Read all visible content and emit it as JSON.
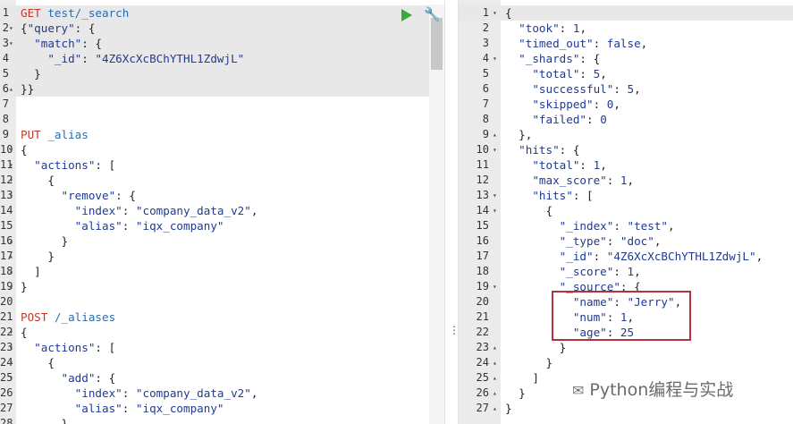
{
  "left_editor": {
    "lines": [
      {
        "n": "1",
        "fold": "",
        "hl": true,
        "tokens": [
          [
            "m",
            "GET"
          ],
          [
            "t",
            " "
          ],
          [
            "u",
            "test/_search"
          ]
        ]
      },
      {
        "n": "2",
        "fold": "▾",
        "hl": true,
        "tokens": [
          [
            "t",
            "{"
          ],
          [
            "k",
            "\"query\""
          ],
          [
            "t",
            ": {"
          ]
        ]
      },
      {
        "n": "3",
        "fold": "▾",
        "hl": true,
        "tokens": [
          [
            "t",
            "  "
          ],
          [
            "k",
            "\"match\""
          ],
          [
            "t",
            ": {"
          ]
        ]
      },
      {
        "n": "4",
        "fold": "",
        "hl": true,
        "tokens": [
          [
            "t",
            "    "
          ],
          [
            "k",
            "\"_id\""
          ],
          [
            "t",
            ": "
          ],
          [
            "s",
            "\"4Z6XcXcBChYTHL1ZdwjL\""
          ]
        ]
      },
      {
        "n": "5",
        "fold": "",
        "hl": true,
        "tokens": [
          [
            "t",
            "  }"
          ]
        ]
      },
      {
        "n": "6",
        "fold": "▴",
        "hl": true,
        "tokens": [
          [
            "t",
            "}}"
          ]
        ]
      },
      {
        "n": "7",
        "fold": "",
        "hl": false,
        "tokens": []
      },
      {
        "n": "8",
        "fold": "",
        "hl": false,
        "tokens": []
      },
      {
        "n": "9",
        "fold": "",
        "hl": false,
        "tokens": [
          [
            "m",
            "PUT"
          ],
          [
            "t",
            " "
          ],
          [
            "u",
            "_alias"
          ]
        ]
      },
      {
        "n": "10",
        "fold": "▾",
        "hl": false,
        "tokens": [
          [
            "t",
            "{"
          ]
        ]
      },
      {
        "n": "11",
        "fold": "▾",
        "hl": false,
        "tokens": [
          [
            "t",
            "  "
          ],
          [
            "k",
            "\"actions\""
          ],
          [
            "t",
            ": ["
          ]
        ]
      },
      {
        "n": "12",
        "fold": "▾",
        "hl": false,
        "tokens": [
          [
            "t",
            "    {"
          ]
        ]
      },
      {
        "n": "13",
        "fold": "▾",
        "hl": false,
        "tokens": [
          [
            "t",
            "      "
          ],
          [
            "k",
            "\"remove\""
          ],
          [
            "t",
            ": {"
          ]
        ]
      },
      {
        "n": "14",
        "fold": "",
        "hl": false,
        "tokens": [
          [
            "t",
            "        "
          ],
          [
            "k",
            "\"index\""
          ],
          [
            "t",
            ": "
          ],
          [
            "s",
            "\"company_data_v2\""
          ],
          [
            "t",
            ","
          ]
        ]
      },
      {
        "n": "15",
        "fold": "",
        "hl": false,
        "tokens": [
          [
            "t",
            "        "
          ],
          [
            "k",
            "\"alias\""
          ],
          [
            "t",
            ": "
          ],
          [
            "s",
            "\"iqx_company\""
          ]
        ]
      },
      {
        "n": "16",
        "fold": "▴",
        "hl": false,
        "tokens": [
          [
            "t",
            "      }"
          ]
        ]
      },
      {
        "n": "17",
        "fold": "▴",
        "hl": false,
        "tokens": [
          [
            "t",
            "    }"
          ]
        ]
      },
      {
        "n": "18",
        "fold": "▴",
        "hl": false,
        "tokens": [
          [
            "t",
            "  ]"
          ]
        ]
      },
      {
        "n": "19",
        "fold": "▴",
        "hl": false,
        "tokens": [
          [
            "t",
            "}"
          ]
        ]
      },
      {
        "n": "20",
        "fold": "",
        "hl": false,
        "tokens": []
      },
      {
        "n": "21",
        "fold": "",
        "hl": false,
        "tokens": [
          [
            "m",
            "POST"
          ],
          [
            "t",
            " "
          ],
          [
            "u",
            "/_aliases"
          ]
        ]
      },
      {
        "n": "22",
        "fold": "▾",
        "hl": false,
        "tokens": [
          [
            "t",
            "{"
          ]
        ]
      },
      {
        "n": "23",
        "fold": "▾",
        "hl": false,
        "tokens": [
          [
            "t",
            "  "
          ],
          [
            "k",
            "\"actions\""
          ],
          [
            "t",
            ": ["
          ]
        ]
      },
      {
        "n": "24",
        "fold": "▾",
        "hl": false,
        "tokens": [
          [
            "t",
            "    {"
          ]
        ]
      },
      {
        "n": "25",
        "fold": "▾",
        "hl": false,
        "tokens": [
          [
            "t",
            "      "
          ],
          [
            "k",
            "\"add\""
          ],
          [
            "t",
            ": {"
          ]
        ]
      },
      {
        "n": "26",
        "fold": "",
        "hl": false,
        "tokens": [
          [
            "t",
            "        "
          ],
          [
            "k",
            "\"index\""
          ],
          [
            "t",
            ": "
          ],
          [
            "s",
            "\"company_data_v2\""
          ],
          [
            "t",
            ","
          ]
        ]
      },
      {
        "n": "27",
        "fold": "",
        "hl": false,
        "tokens": [
          [
            "t",
            "        "
          ],
          [
            "k",
            "\"alias\""
          ],
          [
            "t",
            ": "
          ],
          [
            "s",
            "\"iqx_company\""
          ]
        ]
      },
      {
        "n": "28",
        "fold": "",
        "hl": false,
        "tokens": [
          [
            "t",
            "      }"
          ]
        ]
      }
    ]
  },
  "right_editor": {
    "lines": [
      {
        "n": "1",
        "fold": "▾",
        "hl": true,
        "tokens": [
          [
            "t",
            "{"
          ]
        ]
      },
      {
        "n": "2",
        "fold": "",
        "tokens": [
          [
            "t",
            "  "
          ],
          [
            "k",
            "\"took\""
          ],
          [
            "t",
            ": "
          ],
          [
            "n",
            "1"
          ],
          [
            "t",
            ","
          ]
        ]
      },
      {
        "n": "3",
        "fold": "",
        "tokens": [
          [
            "t",
            "  "
          ],
          [
            "k",
            "\"timed_out\""
          ],
          [
            "t",
            ": "
          ],
          [
            "b",
            "false"
          ],
          [
            "t",
            ","
          ]
        ]
      },
      {
        "n": "4",
        "fold": "▾",
        "tokens": [
          [
            "t",
            "  "
          ],
          [
            "k",
            "\"_shards\""
          ],
          [
            "t",
            ": {"
          ]
        ]
      },
      {
        "n": "5",
        "fold": "",
        "tokens": [
          [
            "t",
            "    "
          ],
          [
            "k",
            "\"total\""
          ],
          [
            "t",
            ": "
          ],
          [
            "n",
            "5"
          ],
          [
            "t",
            ","
          ]
        ]
      },
      {
        "n": "6",
        "fold": "",
        "tokens": [
          [
            "t",
            "    "
          ],
          [
            "k",
            "\"successful\""
          ],
          [
            "t",
            ": "
          ],
          [
            "n",
            "5"
          ],
          [
            "t",
            ","
          ]
        ]
      },
      {
        "n": "7",
        "fold": "",
        "tokens": [
          [
            "t",
            "    "
          ],
          [
            "k",
            "\"skipped\""
          ],
          [
            "t",
            ": "
          ],
          [
            "n",
            "0"
          ],
          [
            "t",
            ","
          ]
        ]
      },
      {
        "n": "8",
        "fold": "",
        "tokens": [
          [
            "t",
            "    "
          ],
          [
            "k",
            "\"failed\""
          ],
          [
            "t",
            ": "
          ],
          [
            "n",
            "0"
          ]
        ]
      },
      {
        "n": "9",
        "fold": "▴",
        "tokens": [
          [
            "t",
            "  },"
          ]
        ]
      },
      {
        "n": "10",
        "fold": "▾",
        "tokens": [
          [
            "t",
            "  "
          ],
          [
            "k",
            "\"hits\""
          ],
          [
            "t",
            ": {"
          ]
        ]
      },
      {
        "n": "11",
        "fold": "",
        "tokens": [
          [
            "t",
            "    "
          ],
          [
            "k",
            "\"total\""
          ],
          [
            "t",
            ": "
          ],
          [
            "n",
            "1"
          ],
          [
            "t",
            ","
          ]
        ]
      },
      {
        "n": "12",
        "fold": "",
        "tokens": [
          [
            "t",
            "    "
          ],
          [
            "k",
            "\"max_score\""
          ],
          [
            "t",
            ": "
          ],
          [
            "n",
            "1"
          ],
          [
            "t",
            ","
          ]
        ]
      },
      {
        "n": "13",
        "fold": "▾",
        "tokens": [
          [
            "t",
            "    "
          ],
          [
            "k",
            "\"hits\""
          ],
          [
            "t",
            ": ["
          ]
        ]
      },
      {
        "n": "14",
        "fold": "▾",
        "tokens": [
          [
            "t",
            "      {"
          ]
        ]
      },
      {
        "n": "15",
        "fold": "",
        "tokens": [
          [
            "t",
            "        "
          ],
          [
            "k",
            "\"_index\""
          ],
          [
            "t",
            ": "
          ],
          [
            "s",
            "\"test\""
          ],
          [
            "t",
            ","
          ]
        ]
      },
      {
        "n": "16",
        "fold": "",
        "tokens": [
          [
            "t",
            "        "
          ],
          [
            "k",
            "\"_type\""
          ],
          [
            "t",
            ": "
          ],
          [
            "s",
            "\"doc\""
          ],
          [
            "t",
            ","
          ]
        ]
      },
      {
        "n": "17",
        "fold": "",
        "tokens": [
          [
            "t",
            "        "
          ],
          [
            "k",
            "\"_id\""
          ],
          [
            "t",
            ": "
          ],
          [
            "s",
            "\"4Z6XcXcBChYTHL1ZdwjL\""
          ],
          [
            "t",
            ","
          ]
        ]
      },
      {
        "n": "18",
        "fold": "",
        "tokens": [
          [
            "t",
            "        "
          ],
          [
            "k",
            "\"_score\""
          ],
          [
            "t",
            ": "
          ],
          [
            "n",
            "1"
          ],
          [
            "t",
            ","
          ]
        ]
      },
      {
        "n": "19",
        "fold": "▾",
        "tokens": [
          [
            "t",
            "        "
          ],
          [
            "k",
            "\"_source\""
          ],
          [
            "t",
            ": {"
          ]
        ]
      },
      {
        "n": "20",
        "fold": "",
        "tokens": [
          [
            "t",
            "          "
          ],
          [
            "k",
            "\"name\""
          ],
          [
            "t",
            ": "
          ],
          [
            "s",
            "\"Jerry\""
          ],
          [
            "t",
            ","
          ]
        ]
      },
      {
        "n": "21",
        "fold": "",
        "tokens": [
          [
            "t",
            "          "
          ],
          [
            "k",
            "\"num\""
          ],
          [
            "t",
            ": "
          ],
          [
            "n",
            "1"
          ],
          [
            "t",
            ","
          ]
        ]
      },
      {
        "n": "22",
        "fold": "",
        "tokens": [
          [
            "t",
            "          "
          ],
          [
            "k",
            "\"age\""
          ],
          [
            "t",
            ": "
          ],
          [
            "n",
            "25"
          ]
        ]
      },
      {
        "n": "23",
        "fold": "▴",
        "tokens": [
          [
            "t",
            "        }"
          ]
        ]
      },
      {
        "n": "24",
        "fold": "▴",
        "tokens": [
          [
            "t",
            "      }"
          ]
        ]
      },
      {
        "n": "25",
        "fold": "▴",
        "tokens": [
          [
            "t",
            "    ]"
          ]
        ]
      },
      {
        "n": "26",
        "fold": "▴",
        "tokens": [
          [
            "t",
            "  }"
          ]
        ]
      },
      {
        "n": "27",
        "fold": "▴",
        "tokens": [
          [
            "t",
            "}"
          ]
        ]
      }
    ]
  },
  "toolbar": {
    "run_icon": "play-icon",
    "settings_icon": "wrench-icon"
  },
  "divider": {
    "grip": "⋮"
  },
  "watermark": {
    "text": "Python编程与实战",
    "icon": "wechat-icon"
  },
  "colors": {
    "method": "#c0392b",
    "url": "#2b6cb0",
    "key": "#1f3a93",
    "highlight_box": "#b5323a",
    "run": "#3aaa35"
  }
}
